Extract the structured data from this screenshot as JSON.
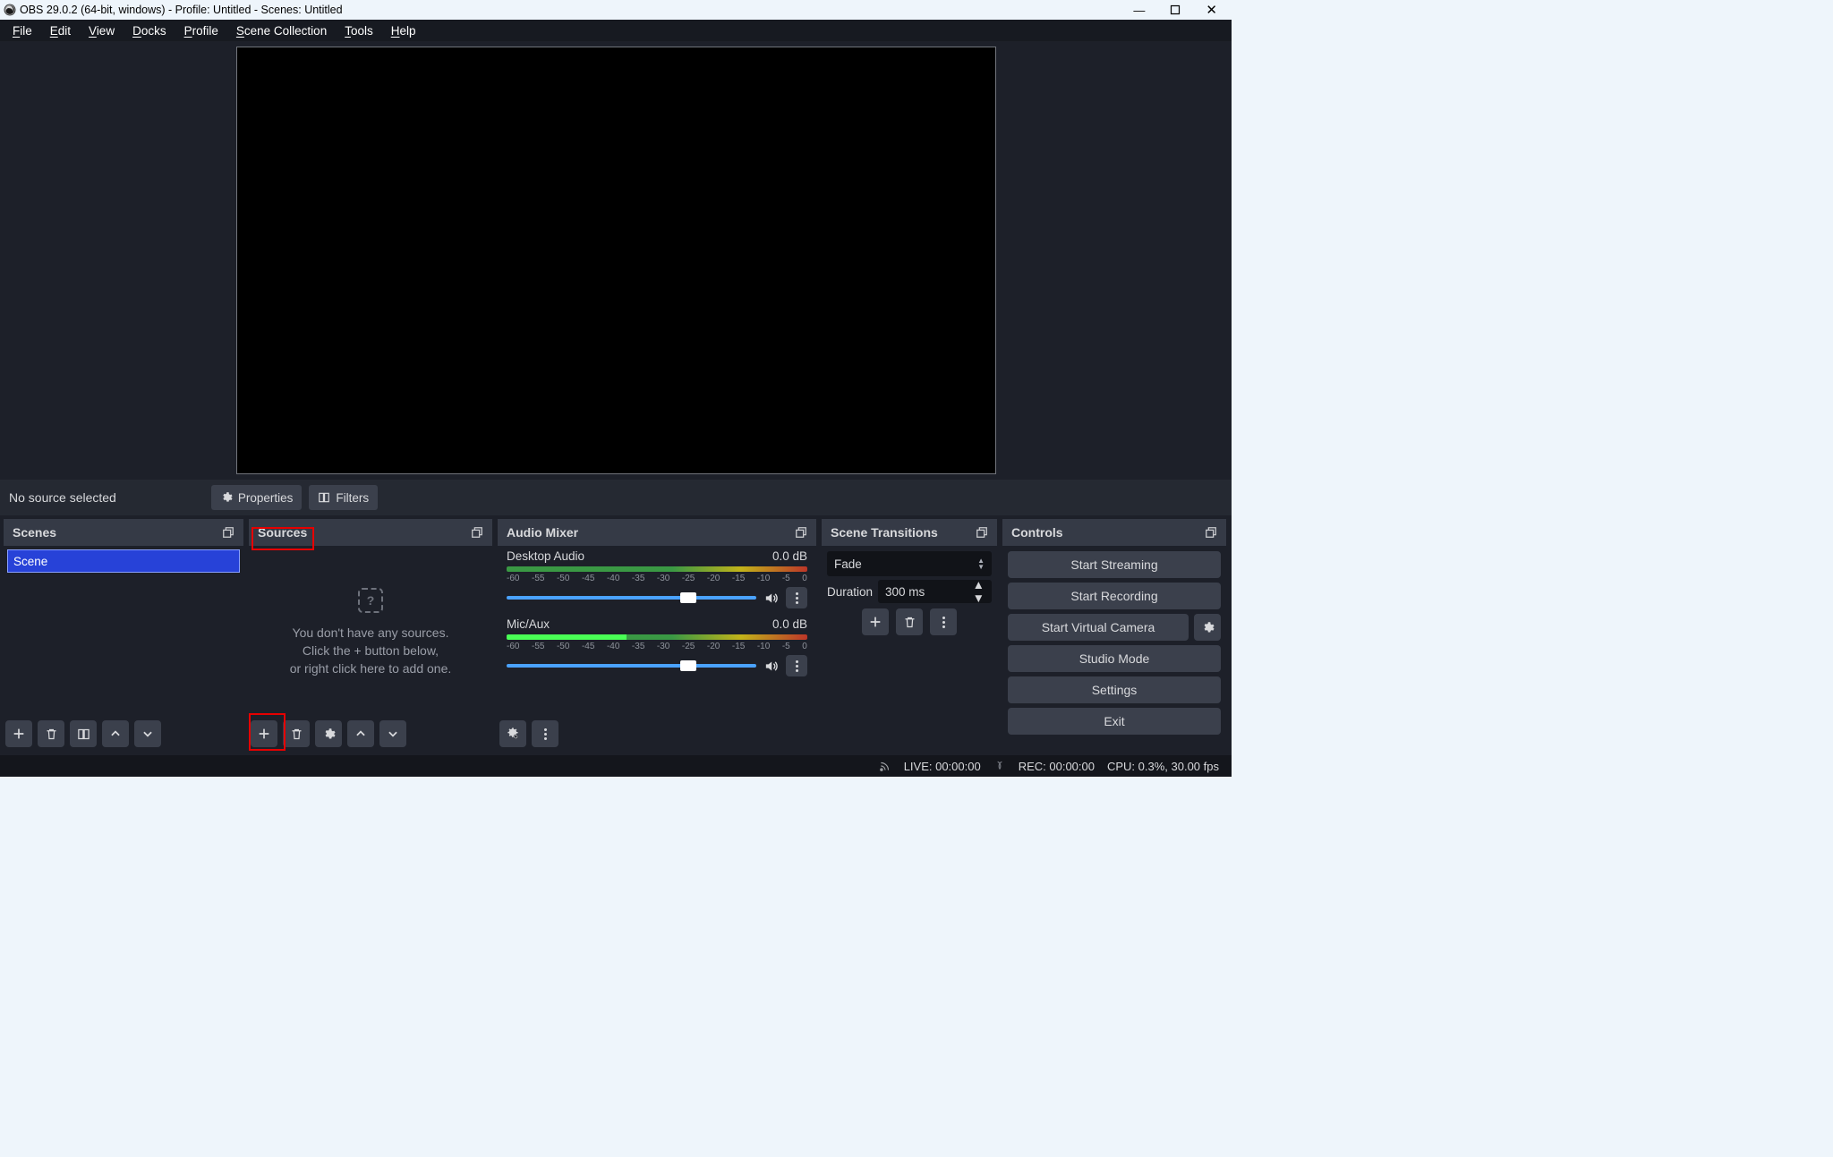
{
  "titlebar": {
    "title": "OBS 29.0.2 (64-bit, windows) - Profile: Untitled - Scenes: Untitled"
  },
  "menu": {
    "file": "File",
    "file_u": "F",
    "edit": "Edit",
    "edit_u": "E",
    "view": "View",
    "view_u": "V",
    "docks": "Docks",
    "docks_u": "D",
    "profile": "Profile",
    "profile_u": "P",
    "scenecol": "Scene Collection",
    "scenecol_u": "S",
    "tools": "Tools",
    "tools_u": "T",
    "help": "Help",
    "help_u": "H"
  },
  "infobar": {
    "no_source": "No source selected",
    "properties": "Properties",
    "filters": "Filters"
  },
  "scenes": {
    "title": "Scenes",
    "items": [
      {
        "name": "Scene"
      }
    ]
  },
  "sources": {
    "title": "Sources",
    "empty_line1": "You don't have any sources.",
    "empty_line2": "Click the + button below,",
    "empty_line3": "or right click here to add one."
  },
  "mixer": {
    "title": "Audio Mixer",
    "ticks": [
      "-60",
      "-55",
      "-50",
      "-45",
      "-40",
      "-35",
      "-30",
      "-25",
      "-20",
      "-15",
      "-10",
      "-5",
      "0"
    ],
    "channels": [
      {
        "name": "Desktop Audio",
        "db": "0.0 dB",
        "level_pct": 0
      },
      {
        "name": "Mic/Aux",
        "db": "0.0 dB",
        "level_pct": 40
      }
    ]
  },
  "transitions": {
    "title": "Scene Transitions",
    "selected": "Fade",
    "duration_label": "Duration",
    "duration_value": "300 ms"
  },
  "controls": {
    "title": "Controls",
    "start_streaming": "Start Streaming",
    "start_recording": "Start Recording",
    "start_vcam": "Start Virtual Camera",
    "studio_mode": "Studio Mode",
    "settings": "Settings",
    "exit": "Exit"
  },
  "status": {
    "live": "LIVE: 00:00:00",
    "rec": "REC: 00:00:00",
    "cpu": "CPU: 0.3%, 30.00 fps"
  }
}
